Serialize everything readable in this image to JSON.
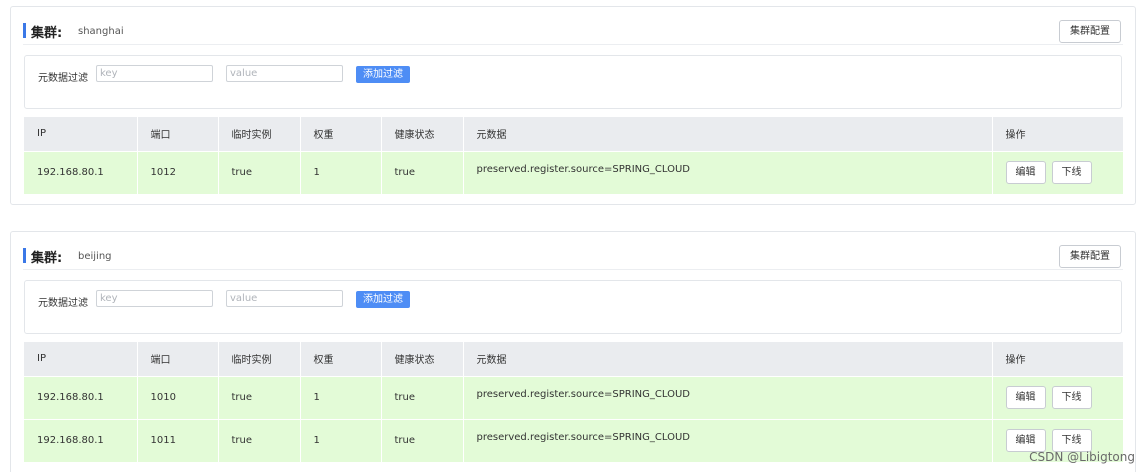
{
  "clusters": [
    {
      "label": "集群:",
      "name": "shanghai",
      "config_button": "集群配置",
      "filter": {
        "label": "元数据过滤",
        "key_placeholder": "key",
        "value_placeholder": "value",
        "add_button": "添加过滤"
      },
      "columns": [
        "IP",
        "端口",
        "临时实例",
        "权重",
        "健康状态",
        "元数据",
        "操作"
      ],
      "rows": [
        {
          "ip": "192.168.80.1",
          "port": "1012",
          "ephemeral": "true",
          "weight": "1",
          "healthy": "true",
          "metadata": "preserved.register.source=SPRING_CLOUD",
          "edit": "编辑",
          "offline": "下线"
        }
      ]
    },
    {
      "label": "集群:",
      "name": "beijing",
      "config_button": "集群配置",
      "filter": {
        "label": "元数据过滤",
        "key_placeholder": "key",
        "value_placeholder": "value",
        "add_button": "添加过滤"
      },
      "columns": [
        "IP",
        "端口",
        "临时实例",
        "权重",
        "健康状态",
        "元数据",
        "操作"
      ],
      "rows": [
        {
          "ip": "192.168.80.1",
          "port": "1010",
          "ephemeral": "true",
          "weight": "1",
          "healthy": "true",
          "metadata": "preserved.register.source=SPRING_CLOUD",
          "edit": "编辑",
          "offline": "下线"
        },
        {
          "ip": "192.168.80.1",
          "port": "1011",
          "ephemeral": "true",
          "weight": "1",
          "healthy": "true",
          "metadata": "preserved.register.source=SPRING_CLOUD",
          "edit": "编辑",
          "offline": "下线"
        }
      ]
    }
  ],
  "watermark": "CSDN @Libigtong",
  "colors": {
    "accent": "#3b78e7",
    "add_button": "#4e8df5",
    "row_bg": "#e3fbd7",
    "header_bg": "#eaecef"
  }
}
